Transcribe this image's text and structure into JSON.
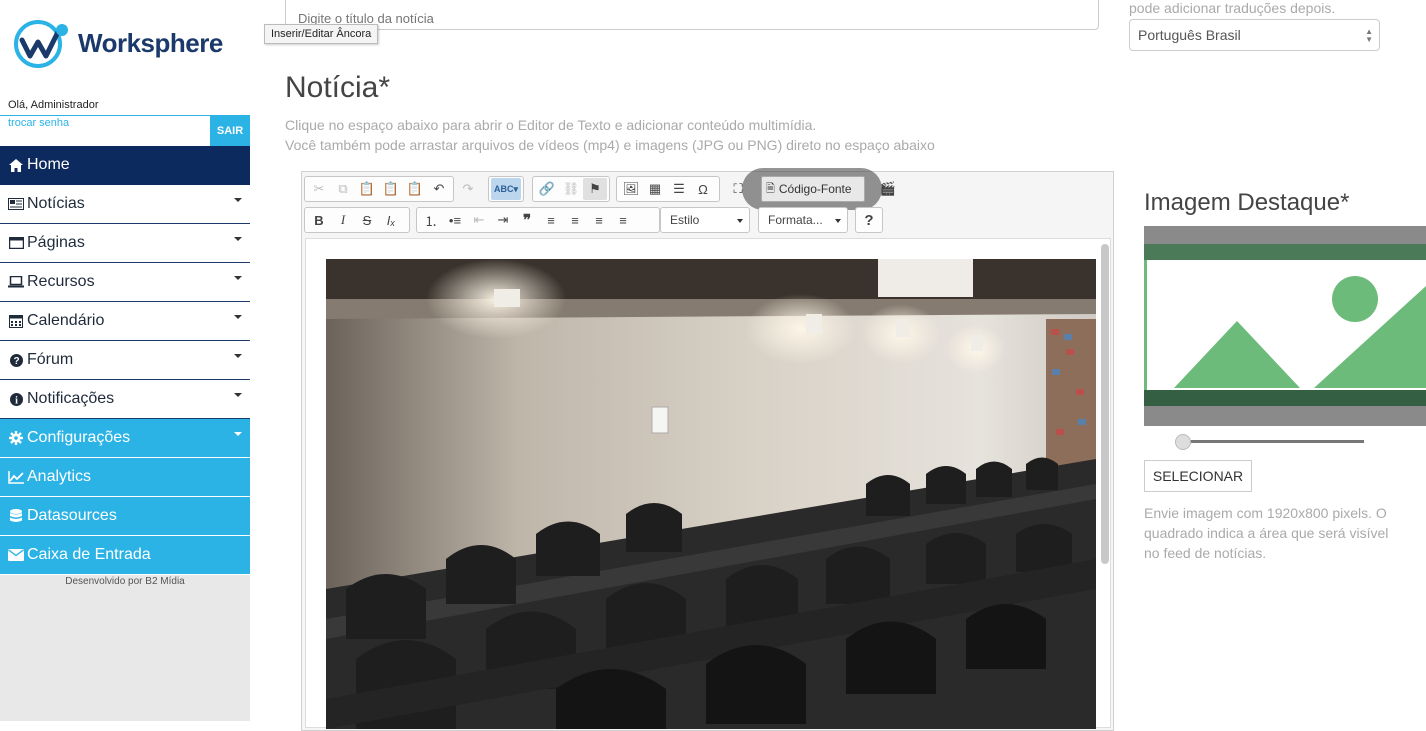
{
  "brand": {
    "name": "Worksphere",
    "colors": {
      "navy": "#0d2a5e",
      "accent": "#2bb3e6"
    }
  },
  "user": {
    "greeting": "Olá, Administrador",
    "change_password": "trocar senha",
    "logout": "SAIR"
  },
  "nav": {
    "items": [
      {
        "label": "Home",
        "icon": "home-icon"
      },
      {
        "label": "Notícias",
        "icon": "newspaper-icon"
      },
      {
        "label": "Páginas",
        "icon": "window-icon"
      },
      {
        "label": "Recursos",
        "icon": "laptop-icon"
      },
      {
        "label": "Calendário",
        "icon": "calendar-icon"
      },
      {
        "label": "Fórum",
        "icon": "question-icon"
      },
      {
        "label": "Notificações",
        "icon": "info-icon"
      },
      {
        "label": "Configurações",
        "icon": "gear-icon"
      },
      {
        "label": "Analytics",
        "icon": "line-chart-icon"
      },
      {
        "label": "Datasources",
        "icon": "database-icon"
      },
      {
        "label": "Caixa de Entrada",
        "icon": "envelope-icon"
      }
    ],
    "credits": "Desenvolvido por B2 Mídia"
  },
  "form": {
    "title_placeholder": "Digite o título da notícia",
    "tooltip": "Inserir/Editar Âncora",
    "lang_hint": "pode adicionar traduções depois.",
    "language": "Português Brasil",
    "noticia_title": "Notícia*",
    "noticia_hint1": "Clique no espaço abaixo para abrir o Editor de Texto e adicionar conteúdo multimídia.",
    "noticia_hint2": "Você também pode arrastar arquivos de vídeos (mp4) e imagens (JPG ou PNG) direto no espaço abaixo"
  },
  "editor": {
    "source_button": "Código-Fonte",
    "style_combo": "Estilo",
    "format_combo": "Formata...",
    "help": "?"
  },
  "featured": {
    "title": "Imagem Destaque*",
    "select_button": "SELECIONAR",
    "hint": "Envie imagem com 1920x800 pixels. O quadrado indica a área que será visível no feed de notícias."
  }
}
